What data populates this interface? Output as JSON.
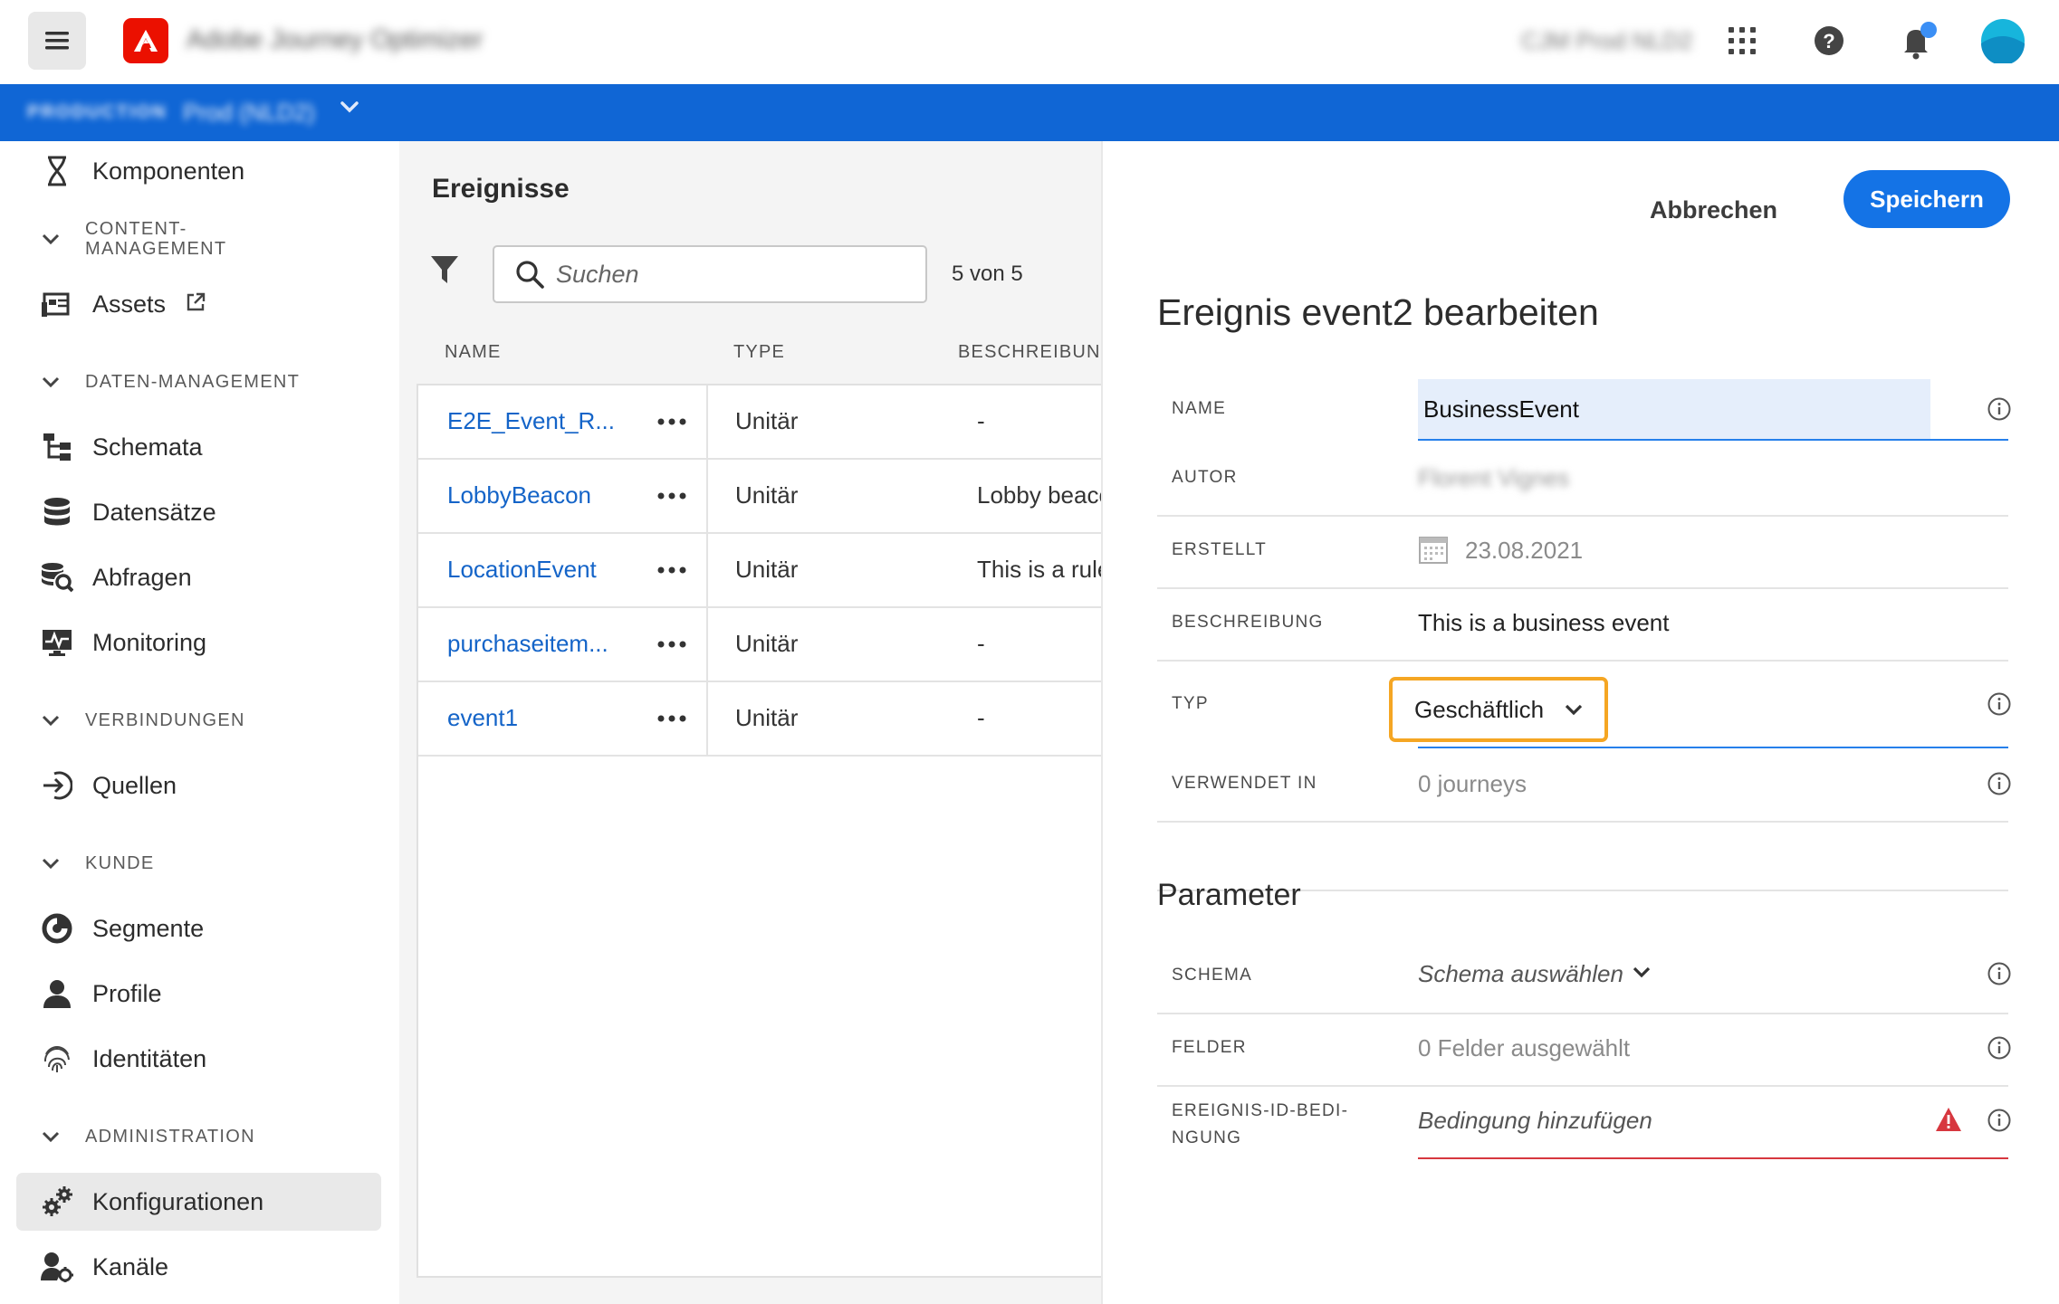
{
  "topbar": {
    "app_name": "Adobe Journey Optimizer",
    "org_name": "CJM Prod NLD2"
  },
  "sandbox": {
    "environment": "PRODUCTION",
    "name": "Prod (NLD2)"
  },
  "sidebar": {
    "items": {
      "komponenten": "Komponenten",
      "assets": "Assets",
      "schemata": "Schemata",
      "datensaetze": "Datensätze",
      "abfragen": "Abfragen",
      "monitoring": "Monitoring",
      "quellen": "Quellen",
      "segmente": "Segmente",
      "profile": "Profile",
      "identitaeten": "Identitäten",
      "konfigurationen": "Konfigurationen",
      "kanaele": "Kanäle"
    },
    "sections": {
      "content_line1": "CONTENT-",
      "content_line2": "MANAGEMENT",
      "daten": "DATEN-MANAGEMENT",
      "verbindungen": "VERBINDUNGEN",
      "kunde": "KUNDE",
      "administration": "ADMINISTRATION"
    }
  },
  "list": {
    "title": "Ereignisse",
    "search_placeholder": "Suchen",
    "count": "5 von 5",
    "columns": {
      "name": "NAME",
      "type": "TYPE",
      "description": "BESCHREIBUNG"
    },
    "rows": [
      {
        "name": "E2E_Event_R...",
        "type": "Unitär",
        "description": "-"
      },
      {
        "name": "LobbyBeacon",
        "type": "Unitär",
        "description": "Lobby beacon"
      },
      {
        "name": "LocationEvent",
        "type": "Unitär",
        "description": "This is a rule-b"
      },
      {
        "name": "purchaseitem...",
        "type": "Unitär",
        "description": "-"
      },
      {
        "name": "event1",
        "type": "Unitär",
        "description": "-"
      }
    ]
  },
  "editor": {
    "cancel_label": "Abbrechen",
    "save_label": "Speichern",
    "title": "Ereignis event2 bearbeiten",
    "fields": {
      "name_label": "NAME",
      "name_value": "BusinessEvent",
      "author_label": "AUTOR",
      "author_value": "Florent Vignes",
      "created_label": "ERSTELLT",
      "created_value": "23.08.2021",
      "description_label": "BESCHREIBUNG",
      "description_value": "This is a business event",
      "type_label": "TYP",
      "type_value": "Geschäftlich",
      "used_in_label": "VERWENDET IN",
      "used_in_value": "0 journeys"
    },
    "parameters": {
      "title": "Parameter",
      "schema_label": "SCHEMA",
      "schema_placeholder": "Schema auswählen",
      "fields_label": "FELDER",
      "fields_value": "0 Felder ausgewählt",
      "condition_label_line1": "EREIGNIS-ID-BEDI-",
      "condition_label_line2": "NGUNG",
      "condition_placeholder": "Bedingung hinzufügen"
    }
  },
  "colors": {
    "sandbox_bar": "#1066d5",
    "primary_button": "#1473e6",
    "link": "#1464c8",
    "highlight_outline": "#f5a623",
    "error": "#d7373f",
    "adobe_red": "#eb1000"
  },
  "icons": [
    "hamburger-icon",
    "adobe-logo-icon",
    "app-switcher-icon",
    "help-icon",
    "bell-icon",
    "avatar",
    "search-icon",
    "filter-icon",
    "info-icon",
    "alert-icon",
    "calendar-icon"
  ]
}
